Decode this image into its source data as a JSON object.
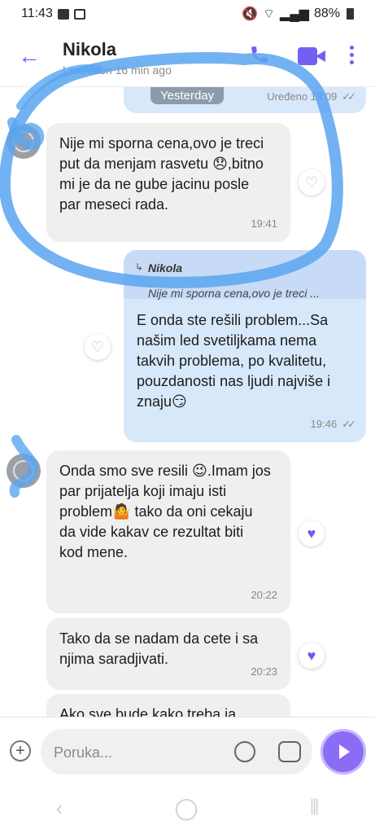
{
  "status_bar": {
    "time": "11:43",
    "battery": "88%"
  },
  "header": {
    "name": "Nikola",
    "last_seen": "Last seen 16 min ago"
  },
  "chat": {
    "date_label": "Yesterday",
    "prev_msg_meta": "Uređeno 19:09",
    "messages": [
      {
        "text": "Nije mi sporna cena,ovo je treci put da menjam rasvetu 😞,bitno mi je da ne gube jacinu posle par meseci rada.",
        "time": "19:41"
      },
      {
        "reply_name": "Nikola",
        "reply_text": "Nije mi sporna cena,ovo je treci ...",
        "text": "E onda ste rešili problem...Sa našim led svetiljkama nema takvih problema, po kvalitetu, pouzdanosti nas ljudi najviše i znaju😏",
        "time": "19:46"
      },
      {
        "text": "Onda smo sve resili 😉.Imam jos par prijatelja koji imaju isti problem🤷 tako da oni cekaju da vide kakav ce rezultat biti kod mene.",
        "time": "20:22"
      },
      {
        "text": "Tako da se nadam da cete i sa njima saradjivati.",
        "time": "20:23"
      },
      {
        "text": "Ako sve bude kako treba,ia"
      }
    ]
  },
  "input": {
    "placeholder": "Poruka..."
  },
  "colors": {
    "accent": "#7360f2",
    "incoming": "#efefef",
    "outgoing": "#d8e8fb",
    "scribble": "#5aa5f0"
  }
}
